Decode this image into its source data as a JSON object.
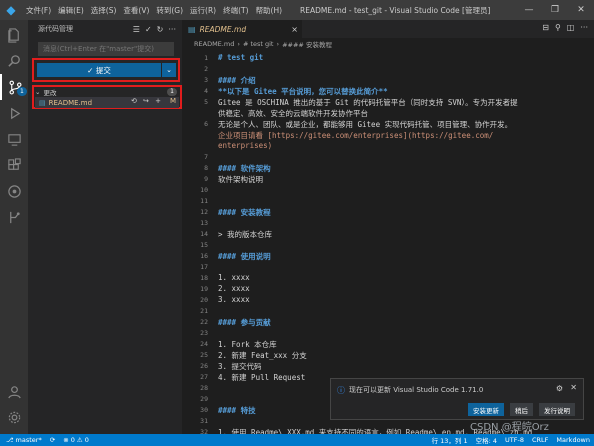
{
  "titlebar": {
    "menu": [
      "文件(F)",
      "编辑(E)",
      "选择(S)",
      "查看(V)",
      "转到(G)",
      "运行(R)",
      "终端(T)",
      "帮助(H)"
    ],
    "title": "README.md - test_git - Visual Studio Code [管理员]",
    "controls": [
      "—",
      "❐",
      "✕"
    ]
  },
  "activitybar": {
    "scm_badge": "1"
  },
  "sidebar": {
    "title": "源代码管理",
    "header_icons": [
      "☰",
      "✓",
      "↻",
      "···"
    ],
    "message_placeholder": "消息(Ctrl+Enter 在\"master\"提交)",
    "commit_button": "✓ 提交",
    "commit_dropdown": "⌄",
    "changes_label": "更改",
    "changes_count": "1",
    "file": {
      "name": "README.md",
      "actions": "⟲ ↪ +",
      "status": "M"
    }
  },
  "tab": {
    "label": "README.md",
    "close": "×",
    "actions": [
      "⊟",
      "⚲",
      "◫",
      "···"
    ]
  },
  "breadcrumb": [
    "README.md",
    "›",
    "# test git",
    "›",
    "#### 安装教程"
  ],
  "editor": {
    "lines": [
      {
        "n": "1",
        "text": "# test git",
        "cls": "c-head"
      },
      {
        "n": "2",
        "text": "",
        "cls": "c-text"
      },
      {
        "n": "3",
        "text": "#### 介绍",
        "cls": "c-head"
      },
      {
        "n": "4",
        "text": "**以下是 Gitee 平台说明，您可以替换此简介**",
        "cls": "c-head"
      },
      {
        "n": "5",
        "text": "Gitee 是 OSCHINA 推出的基于 Git 的代码托管平台（同时支持 SVN）。专为开发者提",
        "cls": "c-text"
      },
      {
        "n": "",
        "text": "供稳定、高效、安全的云端软件开发协作平台",
        "cls": "c-text"
      },
      {
        "n": "6",
        "text": "无论是个人、团队、或是企业，都能够用 Gitee 实现代码托管、项目管理、协作开发。",
        "cls": "c-text"
      },
      {
        "n": "",
        "text": "企业项目请看 [https://gitee.com/enterprises](https://gitee.com/",
        "cls": "c-link"
      },
      {
        "n": "",
        "text": "enterprises)",
        "cls": "c-link"
      },
      {
        "n": "7",
        "text": "",
        "cls": "c-text"
      },
      {
        "n": "8",
        "text": "#### 软件架构",
        "cls": "c-head"
      },
      {
        "n": "9",
        "text": "软件架构说明",
        "cls": "c-text"
      },
      {
        "n": "10",
        "text": "",
        "cls": "c-text"
      },
      {
        "n": "11",
        "text": "",
        "cls": "c-text"
      },
      {
        "n": "12",
        "text": "#### 安装教程",
        "cls": "c-head"
      },
      {
        "n": "13",
        "text": "",
        "cls": "c-text"
      },
      {
        "n": "14",
        "text": "> 我的版本仓库",
        "cls": "c-text"
      },
      {
        "n": "15",
        "text": "",
        "cls": "c-text"
      },
      {
        "n": "16",
        "text": "#### 使用说明",
        "cls": "c-head"
      },
      {
        "n": "17",
        "text": "",
        "cls": "c-text"
      },
      {
        "n": "18",
        "text": "1.  xxxx",
        "cls": "c-text"
      },
      {
        "n": "19",
        "text": "2.  xxxx",
        "cls": "c-text"
      },
      {
        "n": "20",
        "text": "3.  xxxx",
        "cls": "c-text"
      },
      {
        "n": "21",
        "text": "",
        "cls": "c-text"
      },
      {
        "n": "22",
        "text": "#### 参与贡献",
        "cls": "c-head"
      },
      {
        "n": "23",
        "text": "",
        "cls": "c-text"
      },
      {
        "n": "24",
        "text": "1.  Fork 本仓库",
        "cls": "c-text"
      },
      {
        "n": "25",
        "text": "2.  新建 Feat_xxx 分支",
        "cls": "c-text"
      },
      {
        "n": "26",
        "text": "3.  提交代码",
        "cls": "c-text"
      },
      {
        "n": "27",
        "text": "4.  新建 Pull Request",
        "cls": "c-text"
      },
      {
        "n": "28",
        "text": "",
        "cls": "c-text"
      },
      {
        "n": "29",
        "text": "",
        "cls": "c-text"
      },
      {
        "n": "30",
        "text": "#### 特技",
        "cls": "c-head"
      },
      {
        "n": "31",
        "text": "",
        "cls": "c-text"
      },
      {
        "n": "32",
        "text": "1.  使用 Readme\\_XXX.md 来支持不同的语言，例如 Readme\\_en.md, Readme\\_zh.md",
        "cls": "c-text"
      }
    ]
  },
  "notification": {
    "icon": "ⓘ",
    "text": "现在可以更新 Visual Studio Code 1.71.0",
    "buttons": [
      "安装更新",
      "稍后",
      "发行说明"
    ],
    "gear": "⚙",
    "close": "✕"
  },
  "statusbar": {
    "branch": "⎇ master*",
    "sync": "⟳",
    "problems": "⊗ 0 ⚠ 0",
    "position": "行 13，列 1",
    "spaces": "空格: 4",
    "encoding": "UTF-8",
    "eol": "CRLF",
    "language": "Markdown"
  },
  "watermark": "CSDN @程皖Orz"
}
